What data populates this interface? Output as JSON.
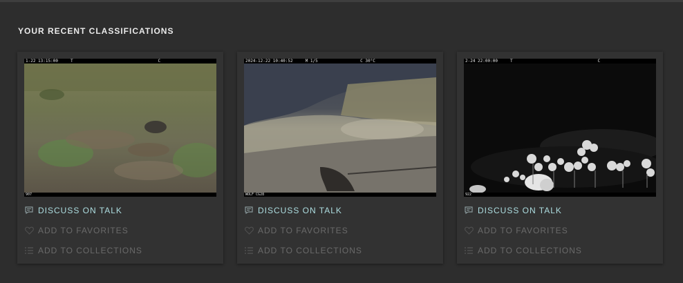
{
  "section": {
    "title": "YOUR RECENT CLASSIFICATIONS"
  },
  "cards": [
    {
      "stamp_top": "1-22 13:15:00     T                                  C",
      "stamp_bottom": "907",
      "talk_label": "DISCUSS ON TALK",
      "fav_label": "ADD TO FAVORITES",
      "coll_label": "ADD TO COLLECTIONS"
    },
    {
      "stamp_top": "2024-12-22 10:40:52     M 1/5                 C 30°C",
      "stamp_bottom": "WOLF CG28",
      "talk_label": "DISCUSS ON TALK",
      "fav_label": "ADD TO FAVORITES",
      "coll_label": "ADD TO COLLECTIONS"
    },
    {
      "stamp_top": "2-24 22:00:00     T                                  C",
      "stamp_bottom": "922",
      "talk_label": "DISCUSS ON TALK",
      "fav_label": "ADD TO FAVORITES",
      "coll_label": "ADD TO COLLECTIONS"
    }
  ],
  "colors": {
    "background": "#2d2d2d",
    "card": "#323232",
    "link_active": "#addde0",
    "link_muted": "#6a6a6a"
  },
  "icons": [
    "chat-bubble-icon",
    "heart-icon",
    "list-icon"
  ]
}
